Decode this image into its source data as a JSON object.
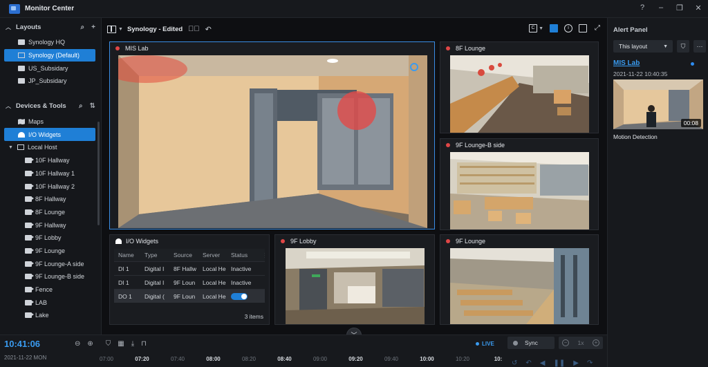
{
  "app": {
    "title": "Monitor Center",
    "win_help": "?",
    "win_min": "–",
    "win_restore": "❐",
    "win_close": "✕"
  },
  "sidebar": {
    "layouts_title": "Layouts",
    "layouts": [
      {
        "label": "Synology HQ",
        "icon": "folder-icon",
        "active": false
      },
      {
        "label": "Synology (Default)",
        "icon": "layout-grid-icon",
        "active": true
      },
      {
        "label": "US_Subsidary",
        "icon": "folder-icon",
        "active": false
      },
      {
        "label": "JP_Subsidary",
        "icon": "folder-icon",
        "active": false
      }
    ],
    "devices_title": "Devices & Tools",
    "tools": [
      {
        "label": "Maps",
        "icon": "map-icon",
        "active": false
      },
      {
        "label": "I/O Widgets",
        "icon": "io-widget-icon",
        "active": true
      }
    ],
    "host": "Local Host",
    "cameras": [
      "10F Hallway",
      "10F Hallway 1",
      "10F Hallway 2",
      "8F Hallway",
      "8F Lounge",
      "9F Hallway",
      "9F Lobby",
      "9F Lounge",
      "9F Lounge-A side",
      "9F Lounge-B side",
      "Fence",
      "LAB",
      "Lake"
    ]
  },
  "header": {
    "layout_name": "Synology - Edited"
  },
  "tiles": {
    "mis_lab": "MIS Lab",
    "lounge_8f": "8F Lounge",
    "lounge_b": "9F Lounge-B side",
    "lobby_9f": "9F Lobby",
    "lounge_9f": "9F Lounge"
  },
  "io_widget": {
    "title": "I/O Widgets",
    "columns": [
      "Name",
      "Type",
      "Source",
      "Server",
      "Status"
    ],
    "rows": [
      {
        "name": "DI 1",
        "type": "Digital I",
        "source": "8F Hallw",
        "server": "Local He",
        "status": "Inactive"
      },
      {
        "name": "DI 1",
        "type": "Digital I",
        "source": "9F Loun",
        "server": "Local He",
        "status": "Inactive"
      },
      {
        "name": "DO 1",
        "type": "Digital (",
        "source": "9F Loun",
        "server": "Local He",
        "status": ""
      }
    ],
    "count": "3 items"
  },
  "alert_panel": {
    "title": "Alert Panel",
    "filter": "This layout",
    "event_title": "MIS Lab",
    "event_time": "2021-11-22 10:40:35",
    "duration": "00:08",
    "event_type": "Motion Detection"
  },
  "timeline": {
    "clock": "10:41:06",
    "date": "2021-11-22 MON",
    "live": "LIVE",
    "ticks": [
      "07:00",
      "07:20",
      "07:40",
      "08:00",
      "08:20",
      "08:40",
      "09:00",
      "09:20",
      "09:40",
      "10:00",
      "10:20",
      "10:"
    ],
    "sync": "Sync",
    "speed": "1x"
  },
  "colors": {
    "accent": "#1f7fd6",
    "link": "#3a9bf0",
    "rec_dot": "#e04646"
  }
}
